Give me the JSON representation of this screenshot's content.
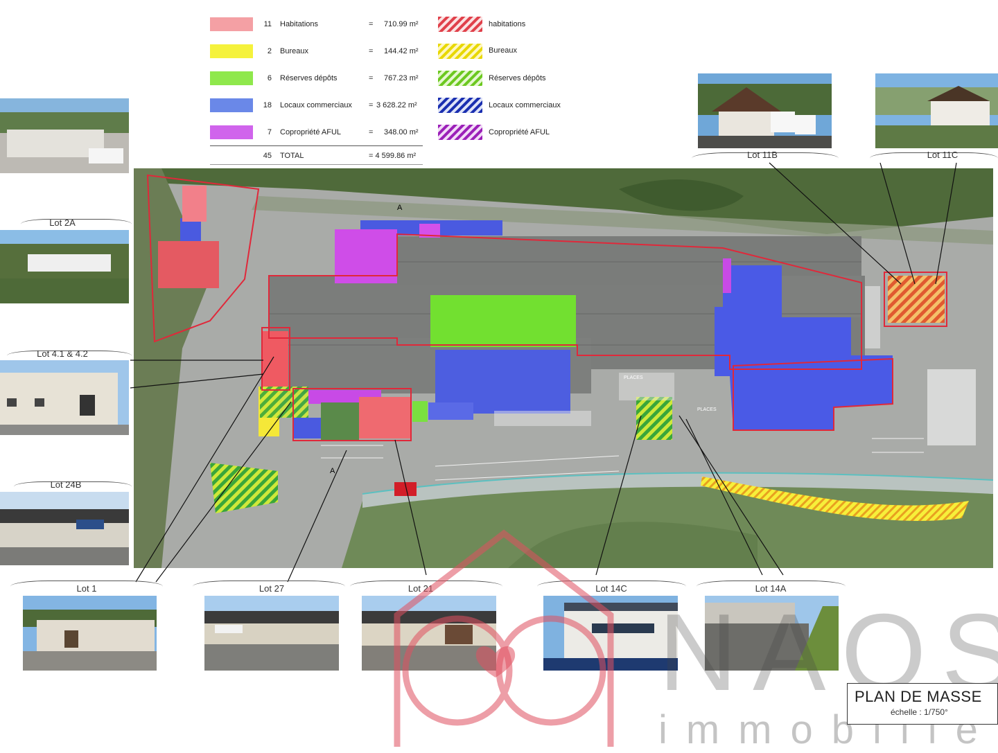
{
  "legend": {
    "rows": [
      {
        "count": "11",
        "label": "Habitations",
        "eq": "=",
        "area": "710.99 m²",
        "hatch_label": "habitations",
        "color": "#f4a0a4"
      },
      {
        "count": "2",
        "label": "Bureaux",
        "eq": "=",
        "area": "144.42 m²",
        "hatch_label": "Bureaux",
        "color": "#f5f23c"
      },
      {
        "count": "6",
        "label": "Réserves dépôts",
        "eq": "=",
        "area": "767.23 m²",
        "hatch_label": "Réserves dépôts",
        "color": "#8fe84c"
      },
      {
        "count": "18",
        "label": "Locaux commerciaux",
        "eq": "=",
        "area": "3 628.22 m²",
        "hatch_label": "Locaux commerciaux",
        "color": "#6a88e8"
      },
      {
        "count": "7",
        "label": "Copropriété AFUL",
        "eq": "=",
        "area": "348.00 m²",
        "hatch_label": "Copropriété AFUL",
        "color": "#d064ec"
      }
    ],
    "total": {
      "count": "45",
      "label": "TOTAL",
      "area": "= 4 599.86 m²"
    }
  },
  "hatch_colors": {
    "habitations": "#e0404a",
    "bureaux": "#e8d800",
    "reserves": "#6cc820",
    "commerciaux": "#1a2fb0",
    "aful": "#9b1fb8"
  },
  "lots": {
    "lot_2a": "Lot 2A",
    "lot_41_42": "Lot 4.1 & 4.2",
    "lot_24b": "Lot 24B",
    "lot_1": "Lot 1",
    "lot_27": "Lot 27",
    "lot_21": "Lot 21",
    "lot_14c": "Lot 14C",
    "lot_14a": "Lot 14A",
    "lot_11b": "Lot 11B",
    "lot_11c": "Lot 11C"
  },
  "map_labels": {
    "section_a": "A",
    "places_1": "PLACES",
    "places_2": "PLACES"
  },
  "title": {
    "main": "PLAN DE MASSE",
    "scale": "échelle : 1/750°"
  },
  "watermark": {
    "brand": "NAOS",
    "sub": "immobilier",
    "color": "#e05060"
  }
}
